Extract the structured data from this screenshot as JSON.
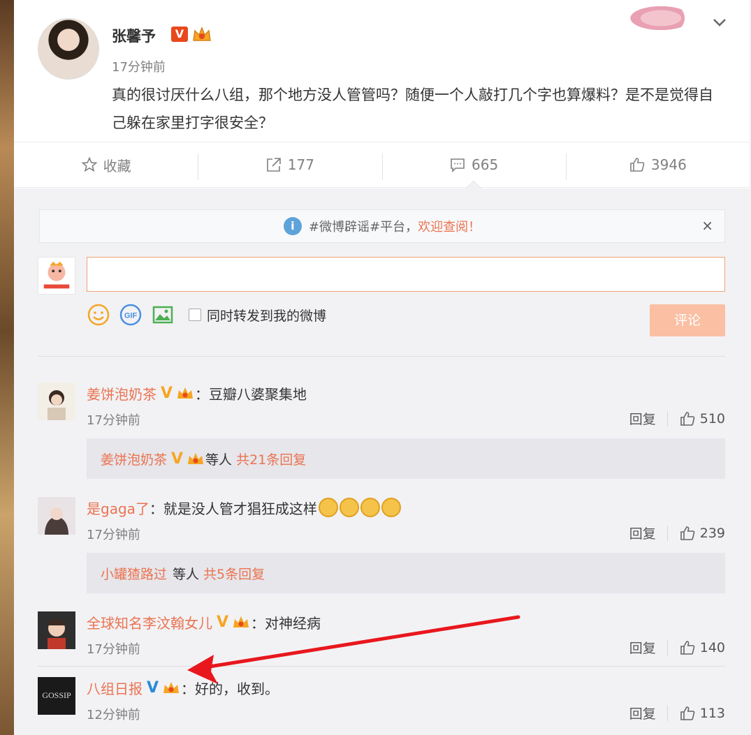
{
  "post": {
    "author": "张馨予",
    "time": "17分钟前",
    "text": "真的很讨厌什么八组，那个地方没人管管吗？随便一个人敲打几个字也算爆料？是不是觉得自己躲在家里打字很安全？"
  },
  "actions": {
    "favorite": "收藏",
    "repost": "177",
    "comment": "665",
    "like": "3946"
  },
  "notice": {
    "prefix": "#微博辟谣#平台，",
    "link": "欢迎查阅！",
    "close": "×"
  },
  "composer": {
    "input_value": "",
    "repost_label": "同时转发到我的微博",
    "submit_label": "评论"
  },
  "comments": [
    {
      "user": "姜饼泡奶茶",
      "badge": "V",
      "text": "：豆瓣八婆聚集地",
      "time": "17分钟前",
      "reply": "回复",
      "likes": "510",
      "replies": {
        "user": "姜饼泡奶茶",
        "badge": "V",
        "suffix": "等人",
        "count": "共21条回复"
      }
    },
    {
      "user": "是gaga了",
      "text": "：就是没人管才猖狂成这样",
      "time": "17分钟前",
      "reply": "回复",
      "likes": "239",
      "replies": {
        "user": "小罐猹路过",
        "suffix": "等人",
        "count": "共5条回复"
      }
    },
    {
      "user": "全球知名李汶翰女儿",
      "badge": "V",
      "text": "：对神经病",
      "time": "17分钟前",
      "reply": "回复",
      "likes": "140"
    },
    {
      "user": "八组日报",
      "badge": "V",
      "text": "：好的，收到。",
      "time": "12分钟前",
      "reply": "回复",
      "likes": "113"
    }
  ],
  "colors": {
    "accent": "#eb7350",
    "gold_v": "#f5a623",
    "blue_v": "#2a8bd8",
    "arrow": "#e8171d"
  }
}
